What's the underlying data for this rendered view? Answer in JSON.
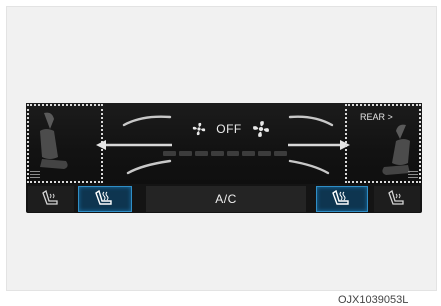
{
  "climate": {
    "fan_status": "OFF",
    "rear_label": "REAR >",
    "ac_label": "A/C",
    "fan_level": 0
  },
  "icons": {
    "fan_left": "fan-icon",
    "fan_right": "fan-icon",
    "seat_ventilation": "seat-ventilation-icon",
    "seat_heating": "seat-heating-icon"
  },
  "colors": {
    "accent": "#2f8ec6",
    "selected_button": "#0e3550"
  },
  "figure_code": "OJX1039053L"
}
